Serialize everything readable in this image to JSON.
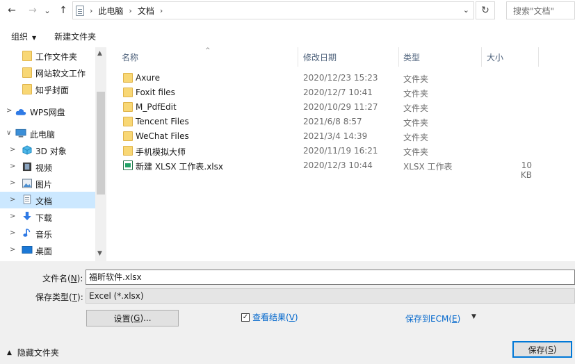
{
  "address_bar": {
    "back": "←",
    "forward": "→",
    "recent_dropdown": "⌄",
    "up": "↑",
    "crumbs": [
      "此电脑",
      "文档"
    ],
    "separator": "›",
    "dropdown": "⌄",
    "refresh": "↻",
    "search_placeholder": "搜索\"文档\""
  },
  "toolbar": {
    "organize": "组织",
    "organize_caret": "▼",
    "new_folder": "新建文件夹"
  },
  "nav": {
    "items": [
      {
        "label": "工作文件夹",
        "icon": "folder-icon",
        "chevron": ""
      },
      {
        "label": "网站软文工作",
        "icon": "folder-icon",
        "chevron": ""
      },
      {
        "label": "知乎封面",
        "icon": "folder-icon",
        "chevron": ""
      },
      {
        "label": "WPS网盘",
        "icon": "cloud-icon",
        "chevron": ">"
      },
      {
        "label": "此电脑",
        "icon": "computer-icon",
        "chevron": "∨"
      },
      {
        "label": "3D 对象",
        "icon": "3d-objects-icon",
        "chevron": ">"
      },
      {
        "label": "视频",
        "icon": "video-icon",
        "chevron": ">"
      },
      {
        "label": "图片",
        "icon": "pictures-icon",
        "chevron": ">"
      },
      {
        "label": "文档",
        "icon": "documents-icon",
        "chevron": ">"
      },
      {
        "label": "下载",
        "icon": "download-icon",
        "chevron": ">"
      },
      {
        "label": "音乐",
        "icon": "music-icon",
        "chevron": ">"
      },
      {
        "label": "桌面",
        "icon": "desktop-icon",
        "chevron": ">"
      }
    ],
    "scroll_up": "▲",
    "scroll_down": "▼"
  },
  "columns": {
    "name": "名称",
    "date": "修改日期",
    "type": "类型",
    "size": "大小",
    "sort_caret": "^"
  },
  "files": [
    {
      "name": "Axure",
      "date": "2020/12/23 15:23",
      "type": "文件夹",
      "size": "",
      "icon": "folder-icon"
    },
    {
      "name": "Foxit files",
      "date": "2020/12/7 10:41",
      "type": "文件夹",
      "size": "",
      "icon": "folder-icon"
    },
    {
      "name": "M_PdfEdit",
      "date": "2020/10/29 11:27",
      "type": "文件夹",
      "size": "",
      "icon": "folder-icon"
    },
    {
      "name": "Tencent Files",
      "date": "2021/6/8 8:57",
      "type": "文件夹",
      "size": "",
      "icon": "folder-icon"
    },
    {
      "name": "WeChat Files",
      "date": "2021/3/4 14:39",
      "type": "文件夹",
      "size": "",
      "icon": "folder-icon"
    },
    {
      "name": "手机模拟大师",
      "date": "2020/11/19 16:21",
      "type": "文件夹",
      "size": "",
      "icon": "folder-icon"
    },
    {
      "name": "新建 XLSX 工作表.xlsx",
      "date": "2020/12/3 10:44",
      "type": "XLSX 工作表",
      "size": "10 KB",
      "icon": "xlsx-file-icon"
    }
  ],
  "bottom": {
    "filename_label_pre": "文件名(",
    "filename_label_key": "N",
    "filename_label_post": "):",
    "filename_value": "福昕软件.xlsx",
    "filetype_label_pre": "保存类型(",
    "filetype_label_key": "T",
    "filetype_label_post": "):",
    "filetype_value": "Excel (*.xlsx)",
    "settings_pre": "设置(",
    "settings_key": "G",
    "settings_post": ")...",
    "check_mark": "✓",
    "view_result_pre": "查看结果(",
    "view_result_key": "V",
    "view_result_post": ")",
    "save_ecm_pre": "保存到ECM(",
    "save_ecm_key": "E",
    "save_ecm_post": ")",
    "ecm_caret": "▼",
    "hide_folders": "隐藏文件夹",
    "hide_chevron": "▲",
    "save_pre": "保存(",
    "save_key": "S",
    "save_post": ")"
  },
  "colors": {
    "selection": "#cce8ff",
    "link": "#0066cc",
    "folder": "#f8d775",
    "accent": "#0078d7"
  }
}
